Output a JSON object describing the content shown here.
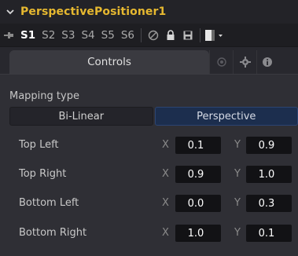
{
  "header": {
    "title": "PerspectivePositioner1"
  },
  "version_bar": {
    "versions": [
      "S1",
      "S2",
      "S3",
      "S4",
      "S5",
      "S6"
    ],
    "active_version": "S1"
  },
  "tabs": {
    "controls_label": "Controls"
  },
  "mapping": {
    "label": "Mapping type",
    "options": [
      "Bi-Linear",
      "Perspective"
    ],
    "selected": "Perspective"
  },
  "corners": [
    {
      "label": "Top Left",
      "x_axis": "X",
      "x": "0.1",
      "y_axis": "Y",
      "y": "0.9"
    },
    {
      "label": "Top Right",
      "x_axis": "X",
      "x": "0.9",
      "y_axis": "Y",
      "y": "1.0"
    },
    {
      "label": "Bottom Left",
      "x_axis": "X",
      "x": "0.0",
      "y_axis": "Y",
      "y": "0.3"
    },
    {
      "label": "Bottom Right",
      "x_axis": "X",
      "x": "1.0",
      "y_axis": "Y",
      "y": "0.1"
    }
  ],
  "colors": {
    "title": "#e6b830",
    "selected_option": "#1c2e4e",
    "field_bg": "#121215"
  }
}
